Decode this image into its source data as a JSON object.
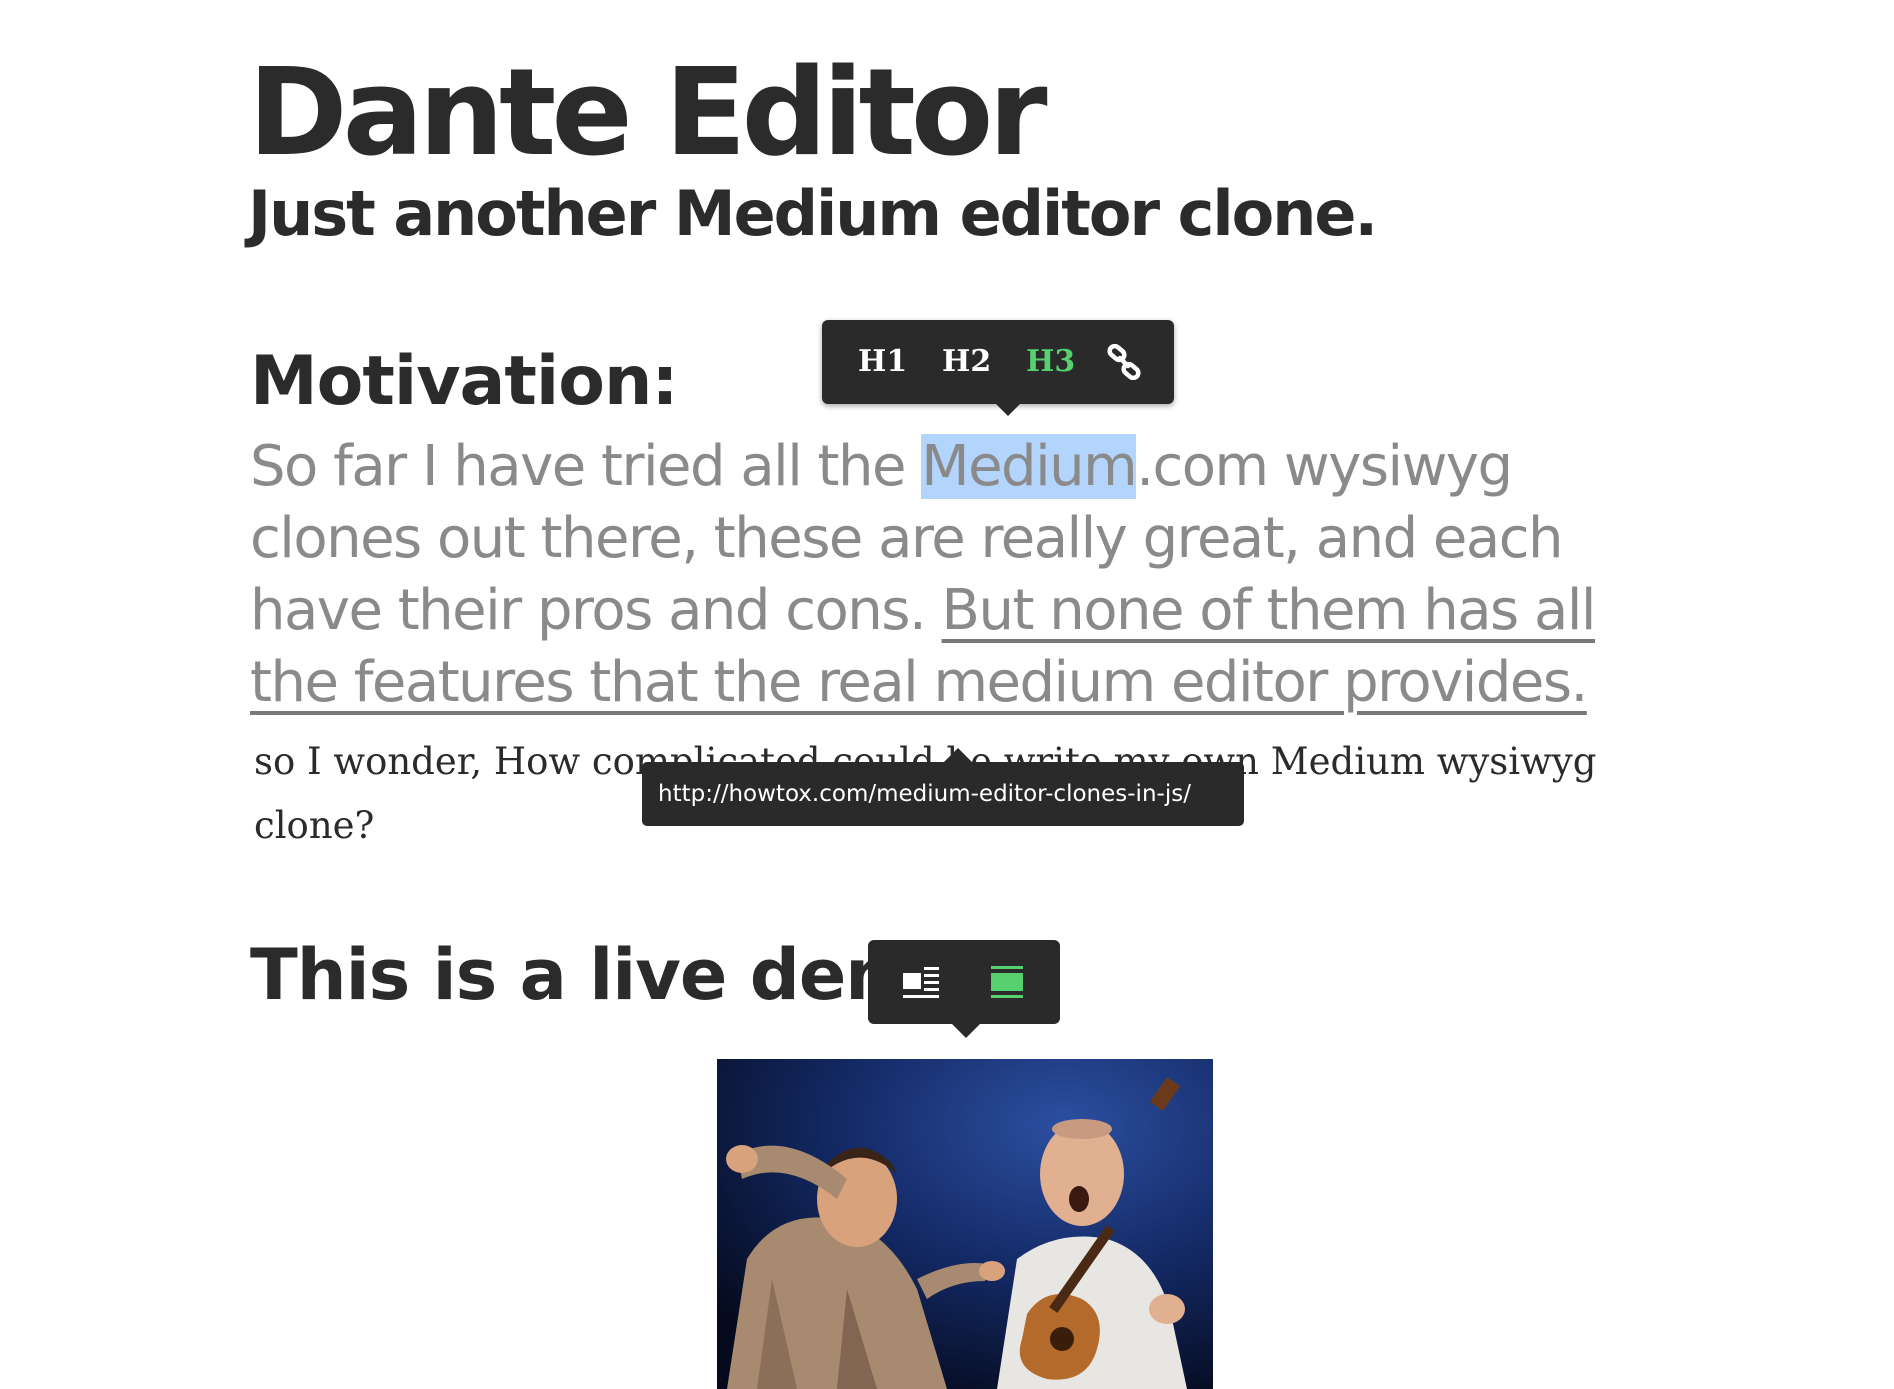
{
  "header": {
    "title": "Dante Editor",
    "subtitle": "Just another Medium editor clone."
  },
  "motivation": {
    "heading": "Motivation:",
    "lead_before": "So far I have tried all the ",
    "lead_selected": "Medium",
    "lead_after": ".com wysiwyg clones out there, these are really great, and each have their pros and cons. ",
    "lead_link": "But none of them has all the features that the real medium editor provides.",
    "serif_text": "so I wonder, How complicated could be write my own Medium wysiwyg clone?"
  },
  "format_toolbar": {
    "buttons": [
      {
        "label": "H1",
        "active": false
      },
      {
        "label": "H2",
        "active": false
      },
      {
        "label": "H3",
        "active": true
      }
    ],
    "link_icon": "link-icon",
    "active_color": "#57d16f",
    "bg_color": "#2a2a2a"
  },
  "link_tooltip": {
    "url": "http://howtox.com/medium-editor-clones-in-js/"
  },
  "demo": {
    "heading": "This is a live dem"
  },
  "image_toolbar": {
    "buttons": [
      {
        "icon": "align-left-wrap-icon",
        "active": false
      },
      {
        "icon": "full-width-icon",
        "active": true
      }
    ]
  },
  "image": {
    "icon": "gif-photo-two-men-guitar"
  }
}
